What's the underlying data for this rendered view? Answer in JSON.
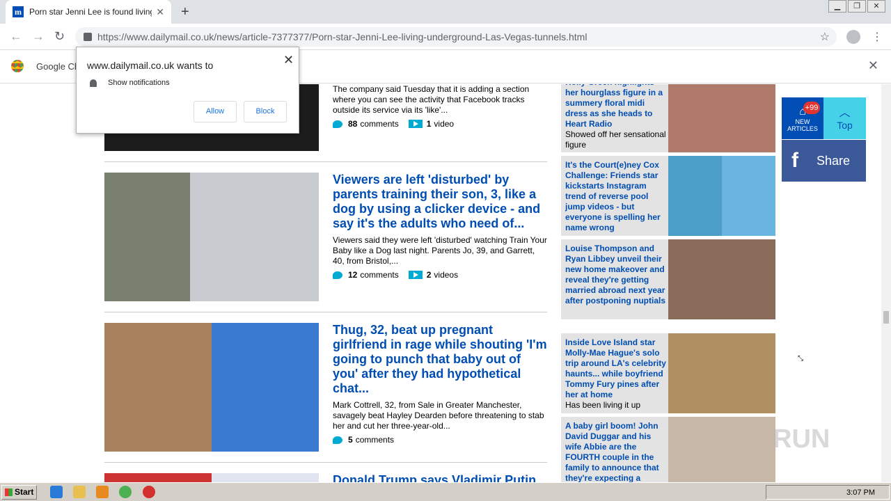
{
  "tab": {
    "title": "Porn star Jenni Lee is found living in",
    "close": "✕"
  },
  "newtab": "+",
  "omnibox": {
    "url": "https://www.dailymail.co.uk/news/article-7377377/Porn-star-Jenni-Lee-living-underground-Las-Vegas-tunnels.html"
  },
  "infobar": {
    "text": "Google Ch",
    "close": "✕"
  },
  "popup": {
    "title": "www.dailymail.co.uk wants to",
    "item": "Show notifications",
    "allow": "Allow",
    "block": "Block",
    "close": "✕"
  },
  "articles": [
    {
      "title": "",
      "snippet": "The company said Tuesday that it is adding a section where you can see the activity that Facebook tracks outside its service via its 'like'...",
      "comments": "88",
      "comments_label": "comments",
      "videos": "1",
      "videos_label": "video"
    },
    {
      "title": "Viewers are left 'disturbed' by parents training their son, 3, like a dog by using a clicker device - and say it's the adults who need of...",
      "snippet": "Viewers said they were left 'disturbed' watching Train Your Baby like a Dog last night. Parents Jo, 39, and Garrett, 40, from Bristol,...",
      "comments": "12",
      "comments_label": "comments",
      "videos": "2",
      "videos_label": "videos"
    },
    {
      "title": "Thug, 32, beat up pregnant girlfriend in rage while shouting 'I'm going to punch that baby out of you' after they had hypothetical chat...",
      "snippet": "Mark Cottrell, 32, from Sale in Greater Manchester, savagely beat Hayley Dearden before threatening to stab her and cut her three-year-old...",
      "comments": "5",
      "comments_label": "comments"
    },
    {
      "title": "Donald Trump says Vladimir Putin"
    }
  ],
  "side": [
    {
      "title": "Holly Green highlights her hourglass figure in a summery floral midi dress as she heads to Heart Radio",
      "sub": "Showed off her sensational figure"
    },
    {
      "title": "It's the Court(e)ney Cox Challenge: Friends star kickstarts Instagram trend of reverse pool jump videos - but everyone is spelling her name wrong",
      "sub": ""
    },
    {
      "title": "Louise Thompson and Ryan Libbey unveil their new home makeover and reveal they're getting married abroad next year after postponing nuptials",
      "sub": ""
    },
    {
      "title": "Inside Love Island star Molly-Mae Hague's solo trip around LA's celebrity haunts... while boyfriend Tommy Fury pines after her at home",
      "sub": "Has been living it up"
    },
    {
      "title": "A baby girl boom! John David Duggar and his wife Abbie are the FOURTH couple in the family to announce that they're expecting a",
      "sub": ""
    }
  ],
  "share": {
    "new_label": "NEW ARTICLES",
    "badge": "+99",
    "top_label": "Top",
    "share_label": "Share"
  },
  "taskbar": {
    "start": "Start",
    "clock": "3:07 PM"
  },
  "watermark": "RUN"
}
